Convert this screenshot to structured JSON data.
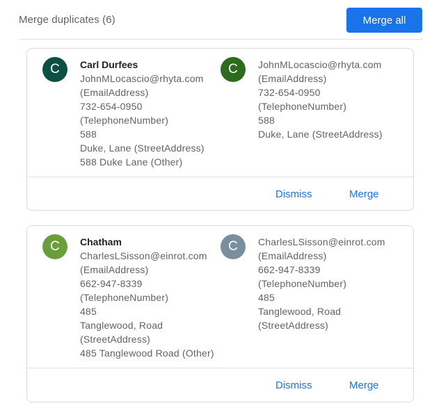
{
  "header": {
    "title": "Merge duplicates (6)",
    "merge_all_label": "Merge all"
  },
  "cards": [
    {
      "left": {
        "initial": "C",
        "avatar_color": "#0b4f45",
        "name": "Carl Durfees",
        "lines": [
          "JohnMLocascio@rhyta.com",
          "(EmailAddress)",
          "732-654-0950",
          "(TelephoneNumber)",
          "588",
          "Duke, Lane (StreetAddress)",
          "588 Duke Lane (Other)"
        ]
      },
      "right": {
        "initial": "C",
        "avatar_color": "#2e6b1f",
        "lines": [
          "JohnMLocascio@rhyta.com",
          "(EmailAddress)",
          "732-654-0950",
          "(TelephoneNumber)",
          "588",
          "Duke, Lane (StreetAddress)"
        ]
      },
      "dismiss_label": "Dismiss",
      "merge_label": "Merge"
    },
    {
      "left": {
        "initial": "C",
        "avatar_color": "#6a9e3b",
        "name": "Chatham",
        "lines": [
          "CharlesLSisson@einrot.com",
          "(EmailAddress)",
          "662-947-8339",
          "(TelephoneNumber)",
          "485",
          "Tanglewood, Road",
          "(StreetAddress)",
          "485 Tanglewood Road (Other)"
        ]
      },
      "right": {
        "initial": "C",
        "avatar_color": "#7a8f9e",
        "lines": [
          "CharlesLSisson@einrot.com",
          "(EmailAddress)",
          "662-947-8339",
          "(TelephoneNumber)",
          "485",
          "Tanglewood, Road",
          "(StreetAddress)"
        ]
      },
      "dismiss_label": "Dismiss",
      "merge_label": "Merge"
    }
  ]
}
